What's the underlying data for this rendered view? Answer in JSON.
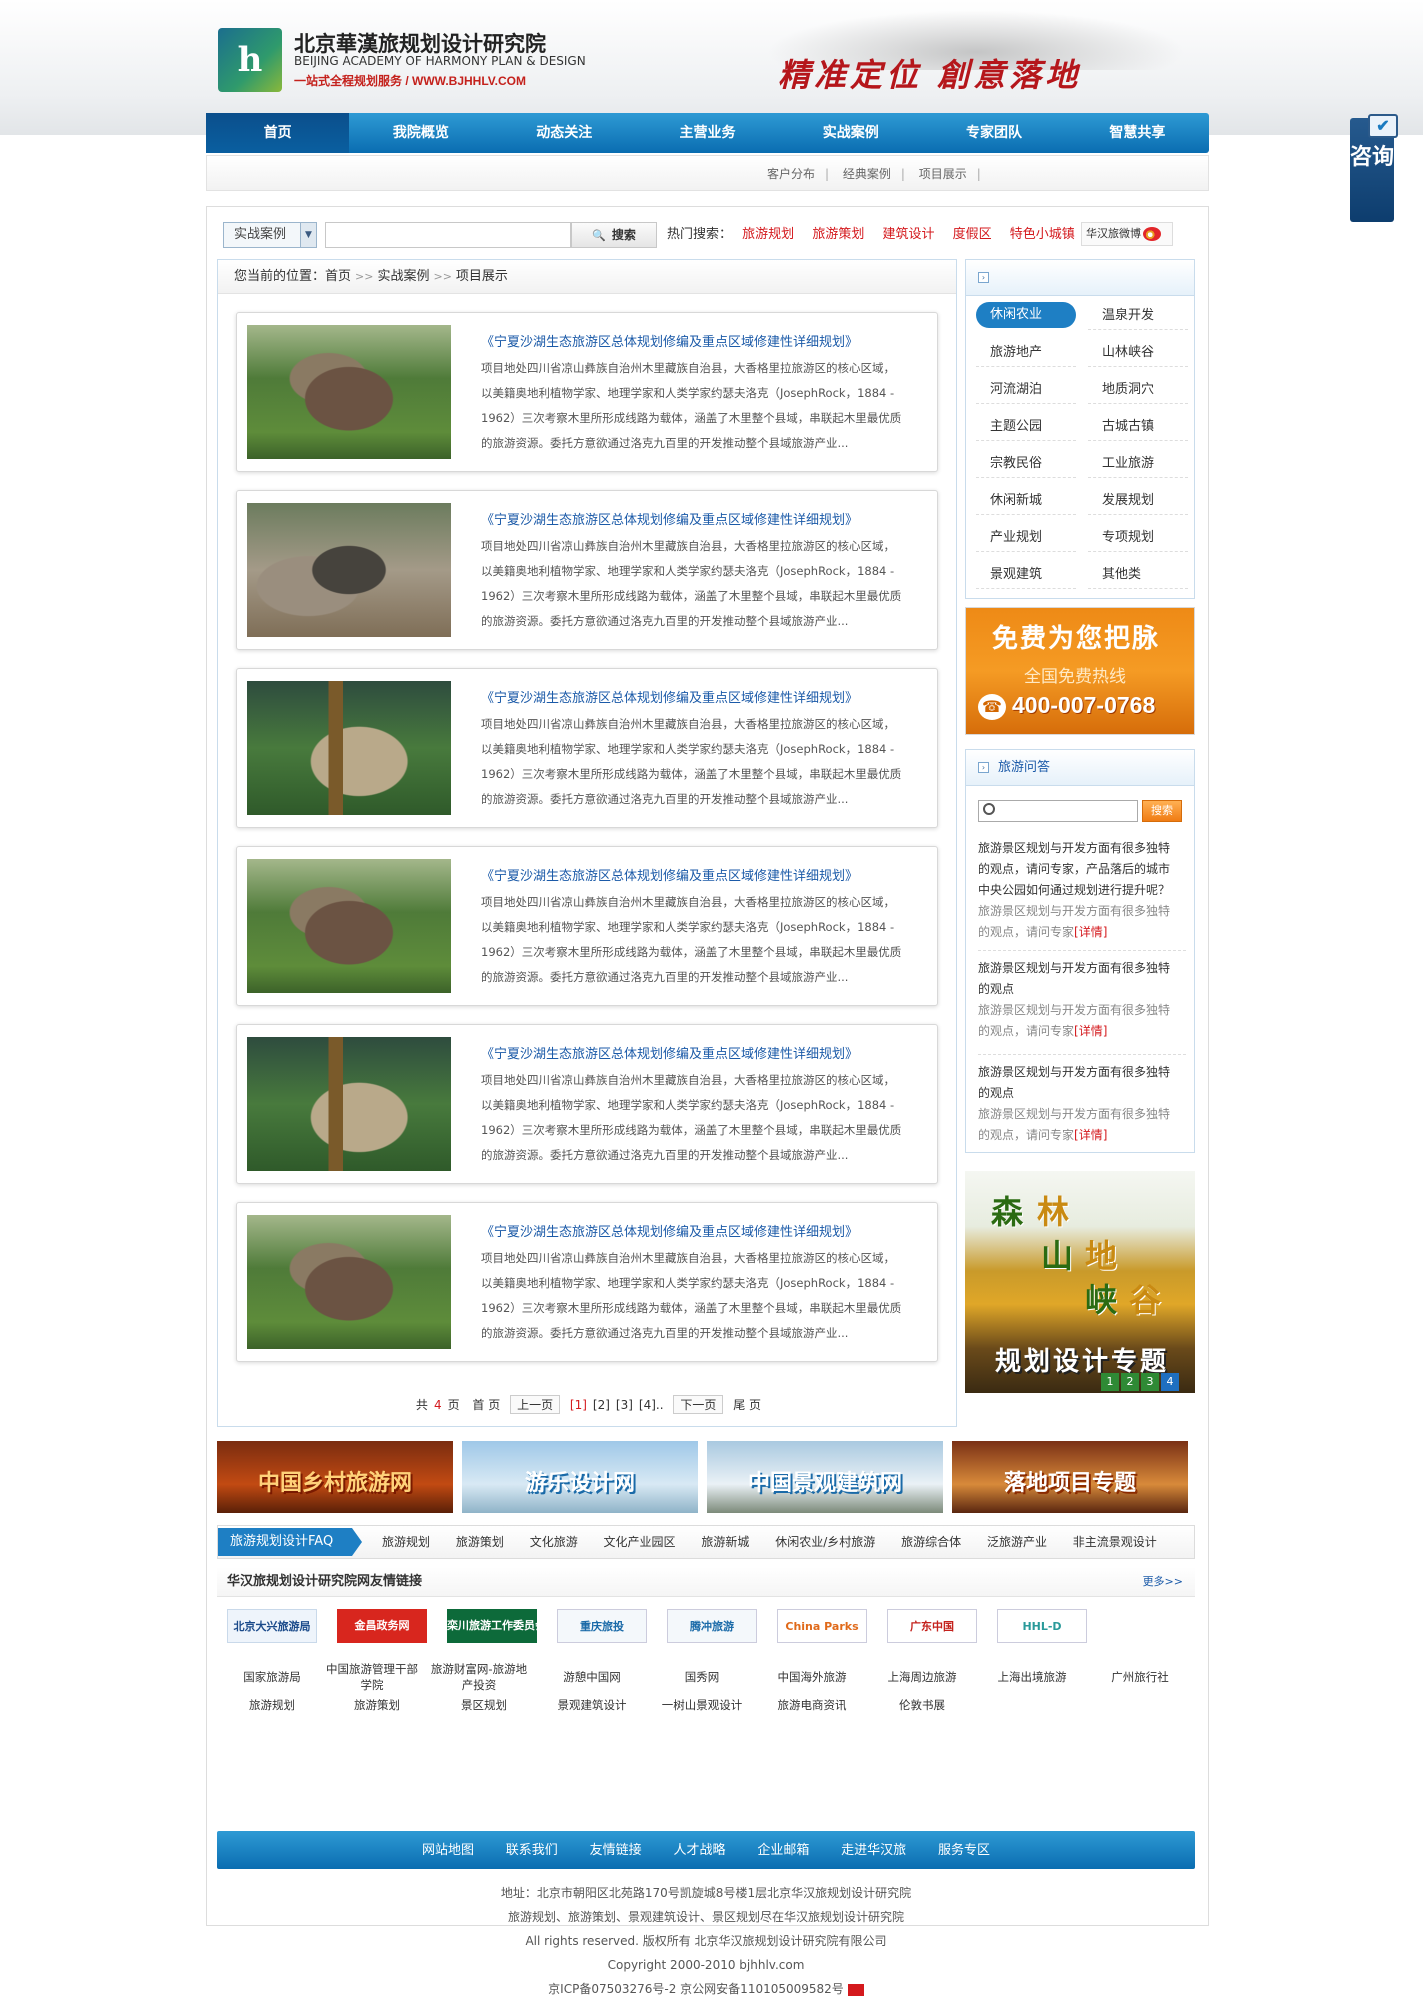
{
  "header": {
    "logo_cn": "北京華漢旅规划设计研究院",
    "logo_en": "BEIJING ACADEMY OF HARMONY PLAN & DESIGN",
    "logo_sub": "一站式全程规划服务 / WWW.BJHHLV.COM",
    "slogan": "精准定位 創意落地"
  },
  "nav": [
    "首页",
    "我院概览",
    "动态关注",
    "主营业务",
    "实战案例",
    "专家团队",
    "智慧共享"
  ],
  "subnav": [
    "客户分布",
    "经典案例",
    "项目展示"
  ],
  "search": {
    "select": "实战案例",
    "button": "搜索",
    "hot_label": "热门搜索：",
    "hot": [
      "旅游规划",
      "旅游策划",
      "建筑设计",
      "度假区",
      "特色小城镇"
    ],
    "weibo": "华汉旅微博"
  },
  "breadcrumb": {
    "prefix": "您当前的位置：",
    "home": "首页",
    "section": "实战案例",
    "page": "项目展示"
  },
  "items": [
    {
      "title": "《宁夏沙湖生态旅游区总体规划修编及重点区域修建性详细规划》",
      "lines": [
        "项目地处四川省凉山彝族自治州木里藏族自治县，大香格里拉旅游区的核心区域，",
        "以美籍奥地利植物学家、地理学家和人类学家约瑟夫洛克（JosephRock，1884 -",
        "1962）三次考察木里所形成线路为载体，涵盖了木里整个县域，串联起木里最优质",
        "的旅游资源。委托方意欲通过洛克九百里的开发推动整个县域旅游产业..."
      ]
    },
    {
      "title": "《宁夏沙湖生态旅游区总体规划修编及重点区域修建性详细规划》",
      "lines": [
        "项目地处四川省凉山彝族自治州木里藏族自治县，大香格里拉旅游区的核心区域，",
        "以美籍奥地利植物学家、地理学家和人类学家约瑟夫洛克（JosephRock，1884 -",
        "1962）三次考察木里所形成线路为载体，涵盖了木里整个县域，串联起木里最优质",
        "的旅游资源。委托方意欲通过洛克九百里的开发推动整个县域旅游产业..."
      ]
    },
    {
      "title": "《宁夏沙湖生态旅游区总体规划修编及重点区域修建性详细规划》",
      "lines": [
        "项目地处四川省凉山彝族自治州木里藏族自治县，大香格里拉旅游区的核心区域，",
        "以美籍奥地利植物学家、地理学家和人类学家约瑟夫洛克（JosephRock，1884 -",
        "1962）三次考察木里所形成线路为载体，涵盖了木里整个县域，串联起木里最优质",
        "的旅游资源。委托方意欲通过洛克九百里的开发推动整个县域旅游产业..."
      ]
    },
    {
      "title": "《宁夏沙湖生态旅游区总体规划修编及重点区域修建性详细规划》",
      "lines": [
        "项目地处四川省凉山彝族自治州木里藏族自治县，大香格里拉旅游区的核心区域，",
        "以美籍奥地利植物学家、地理学家和人类学家约瑟夫洛克（JosephRock，1884 -",
        "1962）三次考察木里所形成线路为载体，涵盖了木里整个县域，串联起木里最优质",
        "的旅游资源。委托方意欲通过洛克九百里的开发推动整个县域旅游产业..."
      ]
    },
    {
      "title": "《宁夏沙湖生态旅游区总体规划修编及重点区域修建性详细规划》",
      "lines": [
        "项目地处四川省凉山彝族自治州木里藏族自治县，大香格里拉旅游区的核心区域，",
        "以美籍奥地利植物学家、地理学家和人类学家约瑟夫洛克（JosephRock，1884 -",
        "1962）三次考察木里所形成线路为载体，涵盖了木里整个县域，串联起木里最优质",
        "的旅游资源。委托方意欲通过洛克九百里的开发推动整个县域旅游产业..."
      ]
    },
    {
      "title": "《宁夏沙湖生态旅游区总体规划修编及重点区域修建性详细规划》",
      "lines": [
        "项目地处四川省凉山彝族自治州木里藏族自治县，大香格里拉旅游区的核心区域，",
        "以美籍奥地利植物学家、地理学家和人类学家约瑟夫洛克（JosephRock，1884 -",
        "1962）三次考察木里所形成线路为载体，涵盖了木里整个县域，串联起木里最优质",
        "的旅游资源。委托方意欲通过洛克九百里的开发推动整个县域旅游产业..."
      ]
    }
  ],
  "pager": {
    "total_prefix": "共",
    "total": "4",
    "total_suffix": "页",
    "first": "首 页",
    "prev": "上一页",
    "pages": [
      "[1]",
      "[2]",
      "[3]",
      "[4].."
    ],
    "next": "下一页",
    "last": "尾 页"
  },
  "categories": [
    "休闲农业",
    "温泉开发",
    "旅游地产",
    "山林峡谷",
    "河流湖泊",
    "地质洞穴",
    "主题公园",
    "古城古镇",
    "宗教民俗",
    "工业旅游",
    "休闲新城",
    "发展规划",
    "产业规划",
    "专项规划",
    "景观建筑",
    "其他类"
  ],
  "hotline": {
    "line1": "免费为您把脉",
    "line2": "全国免费热线",
    "phone": "400-007-0768"
  },
  "qa": {
    "title": "旅游问答",
    "button": "搜索",
    "items": [
      {
        "q": [
          "旅游景区规划与开发方面有很多独特",
          "的观点，请问专家，产品落后的城市",
          "中央公园如何通过规划进行提升呢？"
        ],
        "a": [
          "旅游景区规划与开发方面有很多独特",
          "的观点，请问专家"
        ],
        "detail": "[详情]"
      },
      {
        "q": [
          "旅游景区规划与开发方面有很多独特",
          "的观点"
        ],
        "a": [
          "旅游景区规划与开发方面有很多独特",
          "的观点，请问专家"
        ],
        "detail": "[详情]"
      },
      {
        "q": [
          "旅游景区规划与开发方面有很多独特",
          "的观点"
        ],
        "a": [
          "旅游景区规划与开发方面有很多独特",
          "的观点，请问专家"
        ],
        "detail": "[详情]"
      }
    ]
  },
  "forest": {
    "chars": [
      "森",
      "林",
      "山",
      "地",
      "峡",
      "谷"
    ],
    "title": "规划设计专题",
    "dots": [
      "1",
      "2",
      "3",
      "4"
    ]
  },
  "banners": [
    "中国乡村旅游网",
    "游乐设计网",
    "中国景观建筑网",
    "落地项目专题"
  ],
  "faq": {
    "title": "旅游规划设计FAQ",
    "links": [
      "旅游规划",
      "旅游策划",
      "文化旅游",
      "文化产业园区",
      "旅游新城",
      "休闲农业/乡村旅游",
      "旅游综合体",
      "泛旅游产业",
      "非主流景观设计"
    ]
  },
  "friends": {
    "title": "华汉旅规划设计研究院网友情链接",
    "more": "更多>>",
    "logos": [
      "北京大兴旅游局",
      "金昌政务网",
      "栾川旅游工作委员会",
      "重庆旅投",
      "腾冲旅游",
      "China Parks",
      "广东中国",
      "HHL-D"
    ],
    "links": [
      "国家旅游局",
      "中国旅游管理干部学院",
      "旅游财富网-旅游地产投资",
      "游憩中国网",
      "国秀网",
      "中国海外旅游",
      "上海周边旅游",
      "上海出境旅游",
      "广州旅行社",
      "旅游规划",
      "旅游策划",
      "景区规划",
      "景观建筑设计",
      "一树山景观设计",
      "旅游电商资讯",
      "伦敦书展"
    ]
  },
  "footnav": [
    "网站地图",
    "联系我们",
    "友情链接",
    "人才战略",
    "企业邮箱",
    "走进华汉旅",
    "服务专区"
  ],
  "footer": [
    "地址：北京市朝阳区北苑路170号凯旋城8号楼1层北京华汉旅规划设计研究院",
    "旅游规划、旅游策划、景观建筑设计、景区规划尽在华汉旅规划设计研究院",
    "All rights reserved. 版权所有 北京华汉旅规划设计研究院有限公司",
    "Copyright 2000-2010 bjhhlv.com",
    "京ICP备07503276号-2   京公网安备110105009582号"
  ],
  "consult": "咨询"
}
